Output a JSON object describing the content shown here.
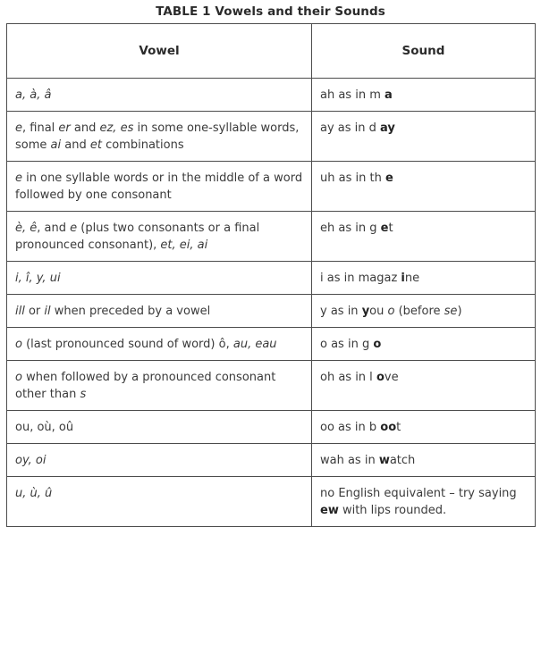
{
  "title": "TABLE 1  Vowels and their Sounds",
  "table": {
    "columns": [
      {
        "key": "vowel",
        "label": "Vowel"
      },
      {
        "key": "sound",
        "label": "Sound"
      }
    ],
    "rows": [
      {
        "vowel_plain": "a, à, â",
        "vowel_html": "<i>a, à, â</i>",
        "sound_plain": "ah as in m a",
        "sound_html": "ah as in m <b>a</b>"
      },
      {
        "vowel_plain": "e, final er and ez, es in some one-syllable words, some ai and et combinations",
        "vowel_html": "<i>e</i>, final <i>er</i> and <i>ez, es</i> in some one-syllable words, some <i>ai</i> and <i>et</i> combinations",
        "sound_plain": "ay as in d ay",
        "sound_html": "ay as in d <b>ay</b>"
      },
      {
        "vowel_plain": "e in one syllable words or in the middle of a word followed by one consonant",
        "vowel_html": "<i>e</i> in one syllable words or in the middle of a word followed by one consonant",
        "sound_plain": "uh as in th e",
        "sound_html": "uh as in th <b>e</b>"
      },
      {
        "vowel_plain": "è, ê, and e (plus two consonants or a final pronounced consonant), et, ei, ai",
        "vowel_html": "<i>è, ê</i>, and <i>e</i> (plus two consonants or a final pronounced consonant), <i>et, ei, ai</i>",
        "sound_plain": "eh as in g et",
        "sound_html": "eh as in g <b>e</b>t"
      },
      {
        "vowel_plain": "i, î, y, ui",
        "vowel_html": "<i>i, î, y, ui</i>",
        "sound_plain": "i as in magaz ine",
        "sound_html": "i as in magaz <b>i</b>ne"
      },
      {
        "vowel_plain": "ill or il when preceded by a vowel",
        "vowel_html": "<i>ill</i> or <i>il</i> when preceded by a vowel",
        "sound_plain": "y as in you o (before se)",
        "sound_html": "y as in <b>y</b>ou <i>o</i> (before <i>se</i>)"
      },
      {
        "vowel_plain": "o (last pronounced sound of word) ô, au, eau",
        "vowel_html": "<i>o</i> (last pronounced sound of word) ô, <i>au, eau</i>",
        "sound_plain": "o as in g o",
        "sound_html": "o as in g <b>o</b>"
      },
      {
        "vowel_plain": "o when followed by a pronounced consonant other than s",
        "vowel_html": "<i>o</i> when followed by a pronounced consonant other than <i>s</i>",
        "sound_plain": "oh as in l ove",
        "sound_html": "oh as in l <b>o</b>ve"
      },
      {
        "vowel_plain": "ou, où, oû",
        "vowel_html": "ou, où, oû",
        "sound_plain": "oo as in b oot",
        "sound_html": "oo as in b <b>oo</b>t"
      },
      {
        "vowel_plain": "oy, oi",
        "vowel_html": "<i>oy, oi</i>",
        "sound_plain": "wah as in watch",
        "sound_html": "wah as in <b>w</b>atch"
      },
      {
        "vowel_plain": "u, ù, û",
        "vowel_html": "<i>u, ù, û</i>",
        "sound_plain": "no English equivalent – try saying ew with lips rounded.",
        "sound_html": "no English equivalent – try saying <b>ew</b> with lips rounded."
      }
    ]
  },
  "colors": {
    "text": "#3a3a3a",
    "heading": "#2b2b2b",
    "outer_border": "#1a1a1a",
    "inner_border": "#4c4c4c",
    "background": "#ffffff"
  }
}
